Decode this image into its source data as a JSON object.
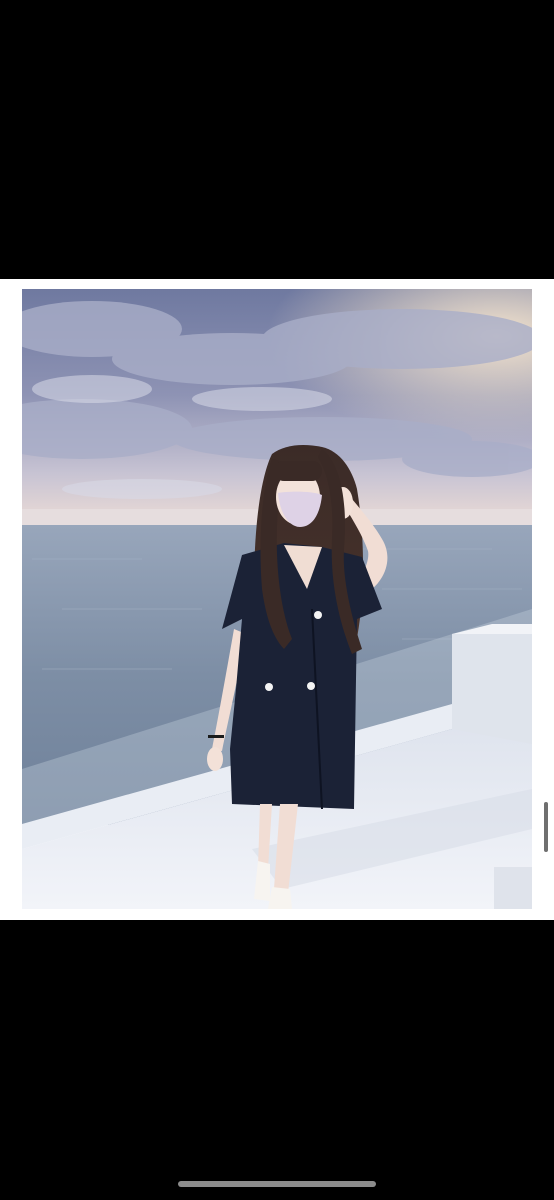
{
  "viewer": {
    "background_color": "#000000",
    "frame_color": "#ffffff"
  },
  "photo": {
    "content": "woman-in-navy-dress-by-sea",
    "colors": {
      "sky_top": "#7d86a8",
      "sky_horizon": "#e8d9d6",
      "sea": "#7f8fa6",
      "dress": "#1b2236",
      "hair": "#3a2a26",
      "deck": "#e6eaf2"
    }
  },
  "controls": {
    "scroll_indicator_icon": "scrollbar",
    "home_indicator_icon": "home-indicator-bar"
  }
}
